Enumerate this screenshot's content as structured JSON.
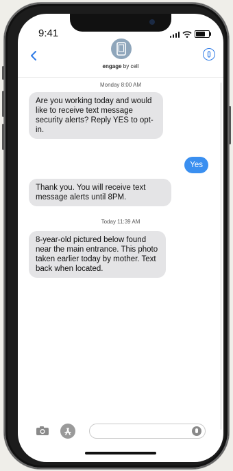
{
  "status_bar": {
    "time": "9:41",
    "battery_level": 0.7
  },
  "header": {
    "back_icon": "chevron-left-icon",
    "brand_bold": "engage",
    "brand_rest": " by cell",
    "info_icon": "info-icon"
  },
  "colors": {
    "accent": "#2f7be6",
    "outgoing_bubble": "#3a8ff0",
    "incoming_bubble": "#e4e4e6"
  },
  "conversation": {
    "stamp1": "Monday 8:00 AM",
    "msg1": "Are you working today and would like to receive text message security alerts? Reply YES to opt-in.",
    "reply1": "Yes",
    "msg2": "Thank you. You will receive text message alerts until 8PM.",
    "stamp2": "Today 11:39 AM",
    "msg3": "8-year-old pictured below found near the main entrance. This photo taken earlier today by mother. Text back when located."
  },
  "composer": {
    "camera_icon": "camera-icon",
    "appstore_icon": "app-store-icon",
    "mic_icon": "microphone-icon",
    "placeholder": ""
  }
}
